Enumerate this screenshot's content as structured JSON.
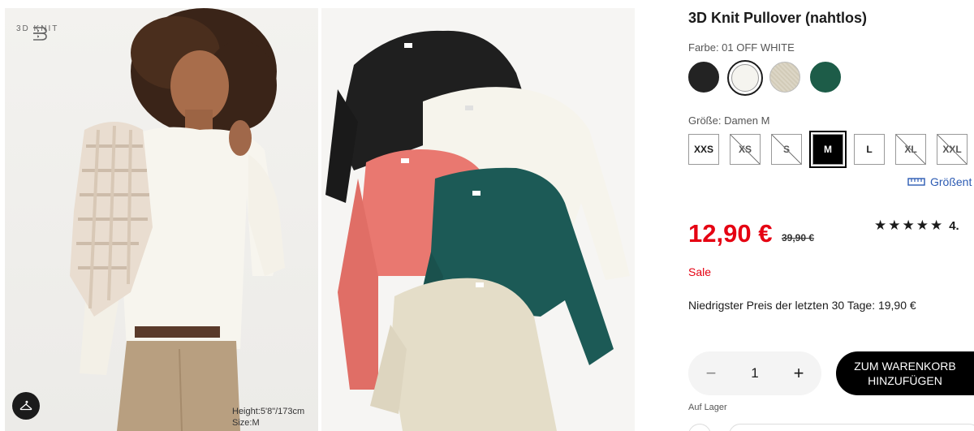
{
  "gallery": {
    "brand_logo_text": "3D KNIT",
    "model_height": "Height:5'8\"/173cm",
    "model_size": "Size:M",
    "hanger_icon": "hanger-icon"
  },
  "product": {
    "title": "3D Knit Pullover (nahtlos)",
    "color_label": "Farbe: 01 OFF WHITE",
    "colors": [
      {
        "name": "black",
        "hex": "#232323",
        "selected": false
      },
      {
        "name": "off-white",
        "hex": "#f5f4ef",
        "selected": true
      },
      {
        "name": "beige",
        "hex": "#dcd6c6",
        "selected": false
      },
      {
        "name": "dark-green",
        "hex": "#1d5c48",
        "selected": false
      }
    ],
    "size_label": "Größe: Damen M",
    "sizes": [
      {
        "label": "XXS",
        "state": "available"
      },
      {
        "label": "XS",
        "state": "unavailable"
      },
      {
        "label": "S",
        "state": "unavailable"
      },
      {
        "label": "M",
        "state": "selected"
      },
      {
        "label": "L",
        "state": "available"
      },
      {
        "label": "XL",
        "state": "unavailable"
      },
      {
        "label": "XXL",
        "state": "unavailable"
      }
    ],
    "size_guide_label": "Größent",
    "price": "12,90 €",
    "old_price": "39,90 €",
    "rating_stars": "★★★★★",
    "rating_value": "4.",
    "sale_label": "Sale",
    "lowest_price_text": "Niedrigster Preis der letzten 30 Tage: 19,90 €",
    "quantity": "1",
    "qty_minus": "−",
    "qty_plus": "+",
    "cart_line1": "ZUM WARENKORB",
    "cart_line2": "HINZUFÜGEN",
    "stock_text": "Auf Lager"
  },
  "colors": {
    "price_red": "#e50012",
    "link_blue": "#2c5bb3"
  }
}
